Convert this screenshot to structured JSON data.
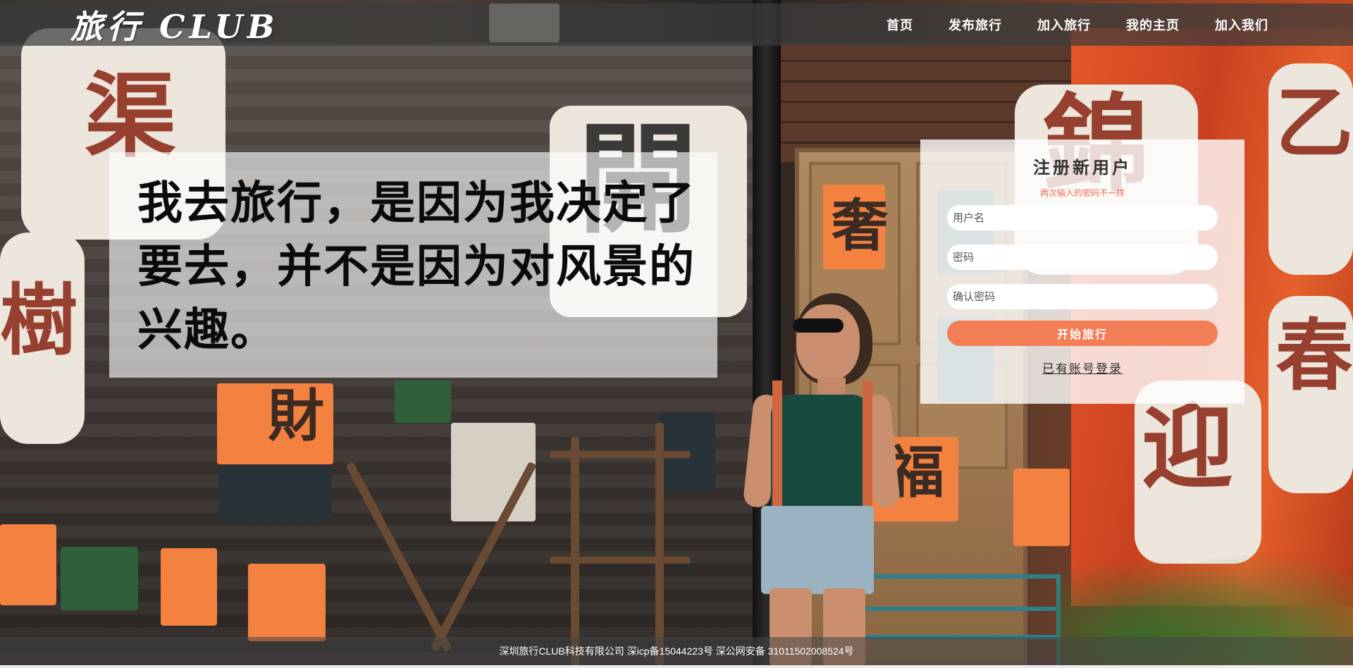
{
  "header": {
    "logo": "旅行 CLUB",
    "nav": [
      {
        "label": "首页"
      },
      {
        "label": "发布旅行"
      },
      {
        "label": "加入旅行"
      },
      {
        "label": "我的主页"
      },
      {
        "label": "加入我们"
      }
    ]
  },
  "quote": {
    "text": "我去旅行，是因为我决定了要去，并不是因为对风景的兴趣。"
  },
  "register": {
    "title": "注册新用户",
    "error": "两次输入的密码不一样",
    "username_placeholder": "用户名",
    "password_placeholder": "密码",
    "confirm_placeholder": "确认密码",
    "submit_label": "开始旅行",
    "login_link": "已有账号登录"
  },
  "footer": {
    "text": "深圳旅行CLUB科技有限公司 深icp备15044223号 深公网安备 31011502008524号"
  },
  "colors": {
    "accent": "#f37e55",
    "error": "#f06a5a",
    "header_bg": "rgba(60,60,60,0.72)"
  }
}
